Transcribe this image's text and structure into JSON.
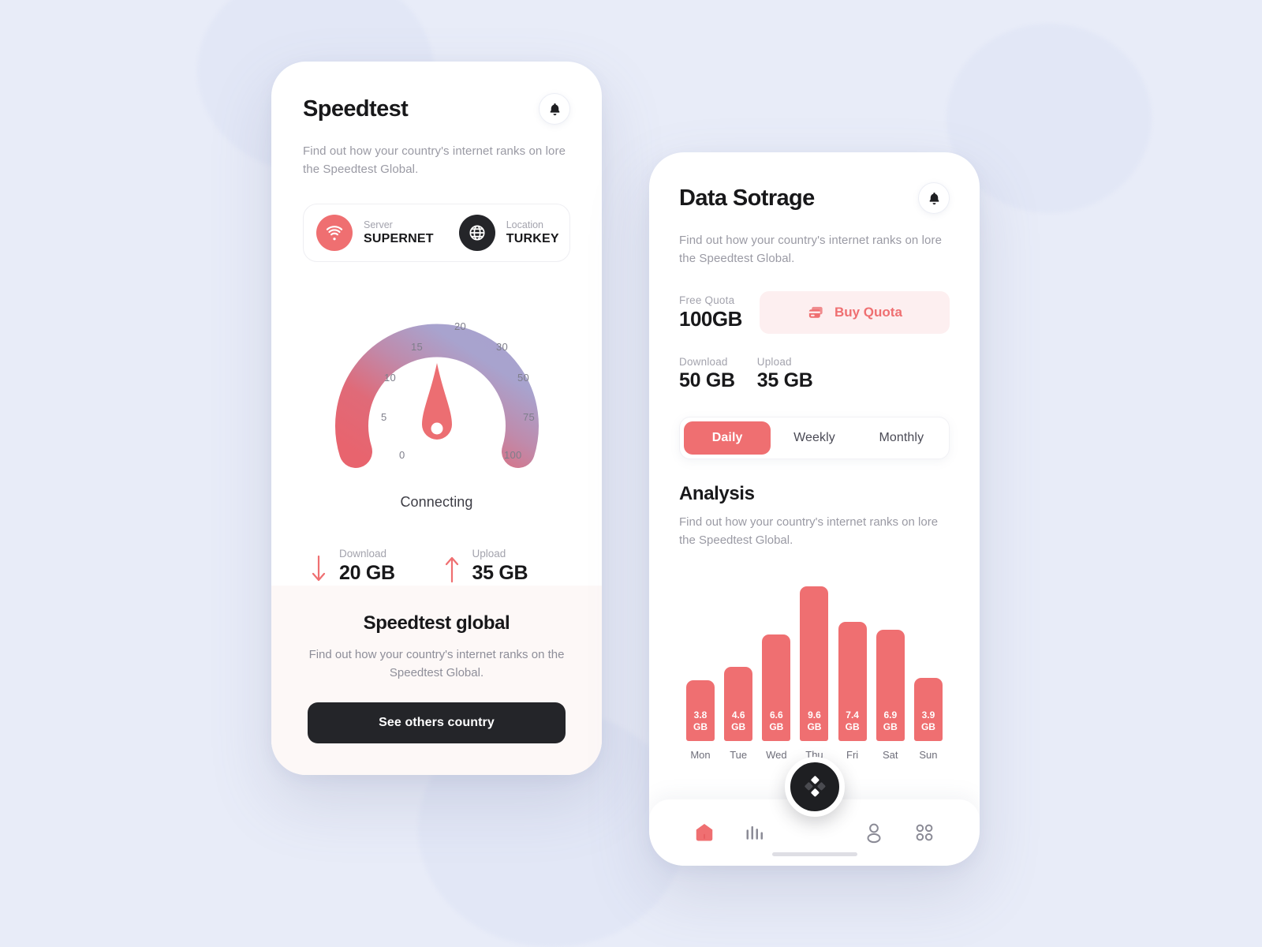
{
  "theme": {
    "accent": "#ef6f71",
    "accent_soft": "#fdeff0",
    "dark": "#242529",
    "page_bg": "#e8ecf8",
    "panel_bg": "#fdf8f7",
    "gauge_from": "#e8646e",
    "gauge_to": "#a8a3ce"
  },
  "speedtest": {
    "title": "Speedtest",
    "bell_icon": "bell-icon",
    "subtitle": "Find out how your country's internet ranks on lore the Speedtest Global.",
    "server": {
      "label": "Server",
      "value": "SUPERNET",
      "icon": "wifi-icon"
    },
    "location": {
      "label": "Location",
      "value": "TURKEY",
      "icon": "globe-icon"
    },
    "gauge": {
      "ticks": [
        "0",
        "5",
        "10",
        "15",
        "20",
        "30",
        "50",
        "75",
        "100"
      ],
      "status": "Connecting",
      "needle_icon": "gauge-needle-icon"
    },
    "download": {
      "label": "Download",
      "value": "20 GB",
      "icon": "arrow-down-icon"
    },
    "upload": {
      "label": "Upload",
      "value": "35 GB",
      "icon": "arrow-up-icon"
    },
    "global_panel": {
      "title": "Speedtest global",
      "subtitle": "Find out how your country's internet ranks on the Speedtest Global.",
      "button": "See others country"
    }
  },
  "storage": {
    "title": "Data Sotrage",
    "bell_icon": "bell-icon",
    "subtitle": "Find out how your country's internet ranks on lore the Speedtest Global.",
    "free_quota": {
      "label": "Free Quota",
      "value": "100GB"
    },
    "buy_quota": {
      "label": "Buy Quota",
      "icon": "credit-card-icon"
    },
    "download": {
      "label": "Download",
      "value": "50 GB"
    },
    "upload": {
      "label": "Upload",
      "value": "35 GB"
    },
    "tabs": [
      {
        "label": "Daily",
        "active": true
      },
      {
        "label": "Weekly",
        "active": false
      },
      {
        "label": "Monthly",
        "active": false
      }
    ],
    "analysis": {
      "title": "Analysis",
      "subtitle": "Find out how your country's internet ranks on lore the Speedtest Global."
    },
    "nav": [
      {
        "name": "home-icon",
        "active": true
      },
      {
        "name": "bar-chart-icon",
        "active": false
      },
      {
        "name": "person-icon",
        "active": false
      },
      {
        "name": "grid-icon",
        "active": false
      }
    ],
    "fab_icon": "diamond-cluster-icon"
  },
  "chart_data": {
    "type": "bar",
    "title": "Analysis",
    "categories": [
      "Mon",
      "Tue",
      "Wed",
      "Thu",
      "Fri",
      "Sat",
      "Sun"
    ],
    "values": [
      3.8,
      4.6,
      6.6,
      9.6,
      7.4,
      6.9,
      3.9
    ],
    "labels": [
      "3.8",
      "4.6",
      "6.6",
      "9.6",
      "7.4",
      "6.9",
      "3.9"
    ],
    "unit": "GB",
    "xlabel": "",
    "ylabel": "",
    "ylim": [
      0,
      10.4
    ],
    "grid": false,
    "legend": false,
    "bar_color": "#ef6f71"
  }
}
